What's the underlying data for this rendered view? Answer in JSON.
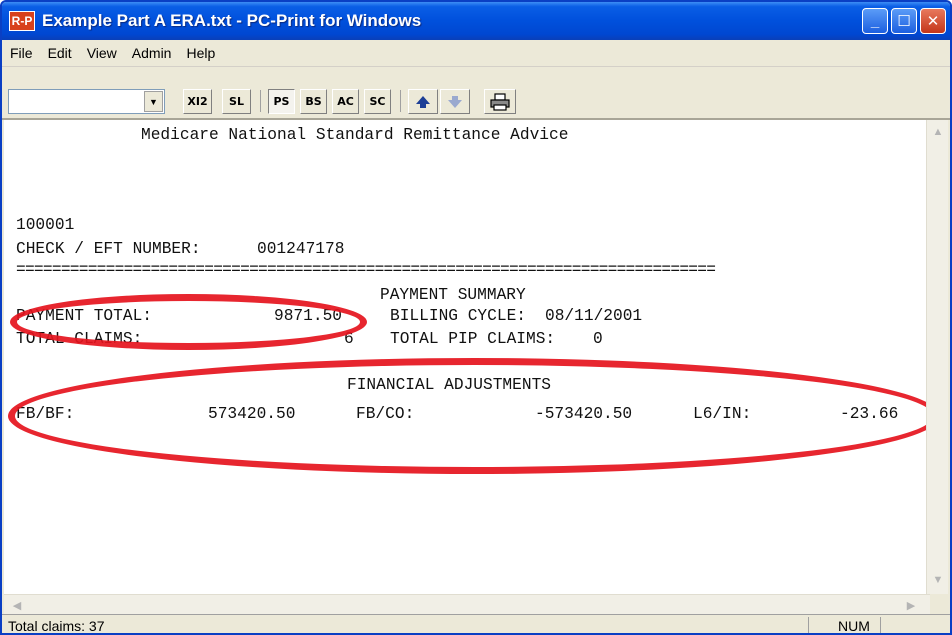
{
  "window": {
    "title": "Example Part A ERA.txt - PC-Print for Windows",
    "app_icon_text": "R-P"
  },
  "menu": [
    "File",
    "Edit",
    "View",
    "Admin",
    "Help"
  ],
  "toolbar": {
    "buttons": [
      "XI2",
      "SL",
      "PS",
      "BS",
      "AC",
      "SC"
    ],
    "combo_value": ""
  },
  "document": {
    "header": "Medicare National Standard Remittance Advice",
    "provider_number": "100001",
    "check_label": "CHECK / EFT NUMBER:",
    "check_value": "001247178",
    "separator": "==============================================================================",
    "payment_summary": {
      "heading": "PAYMENT SUMMARY",
      "payment_total_label": "PAYMENT TOTAL:",
      "payment_total_value": "9871.50",
      "billing_cycle_label": "BILLING CYCLE:",
      "billing_cycle_value": "08/11/2001",
      "total_claims_label": "TOTAL CLAIMS:",
      "total_claims_value": "6",
      "total_pip_claims_label": "TOTAL PIP CLAIMS:",
      "total_pip_claims_value": "0"
    },
    "financial_adjustments": {
      "heading": "FINANCIAL ADJUSTMENTS",
      "items": [
        {
          "label": "FB/BF:",
          "value": "573420.50"
        },
        {
          "label": "FB/CO:",
          "value": "-573420.50"
        },
        {
          "label": "L6/IN:",
          "value": "-23.66"
        }
      ]
    }
  },
  "status": {
    "total_claims": "Total claims: 37",
    "num": "NUM"
  },
  "colors": {
    "annotation": "#e5141d",
    "titlebar": "#0050dc"
  }
}
